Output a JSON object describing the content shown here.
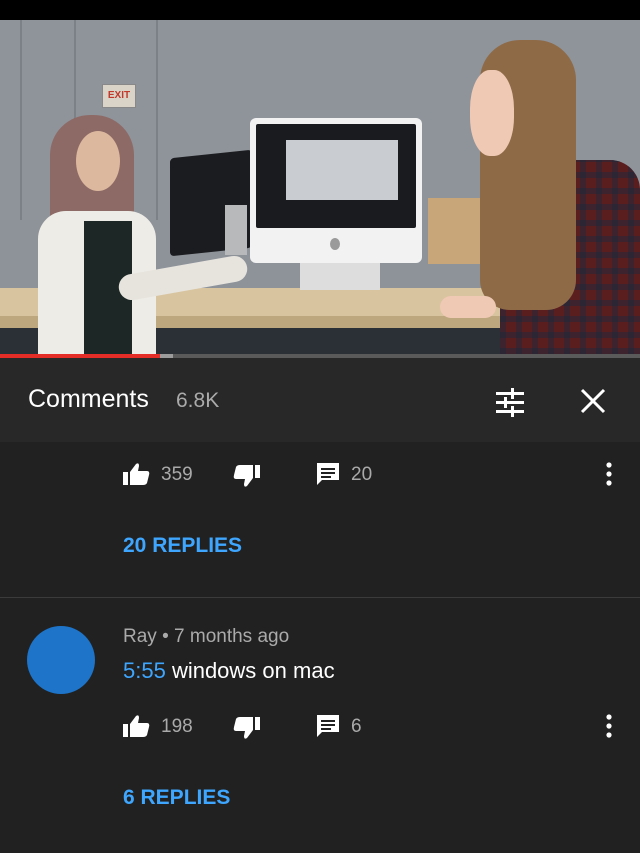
{
  "video": {
    "exit_sign_text": "EXIT",
    "progress_fraction": 0.25,
    "buffer_fraction": 0.27
  },
  "comments": {
    "title": "Comments",
    "count": "6.8K",
    "filter_icon": "sliders-icon",
    "close_icon": "close-icon"
  },
  "comment1": {
    "likes": "359",
    "replies_count": "20",
    "replies_link": "20 REPLIES"
  },
  "comment2": {
    "author": "Ray",
    "separator": "•",
    "age": "7 months ago",
    "timestamp": "5:55",
    "text": " windows on mac",
    "likes": "198",
    "replies_count": "6",
    "replies_link": "6 REPLIES",
    "avatar_color": "#1d74c9"
  },
  "colors": {
    "link": "#3ea6ff",
    "progress": "#e52d27",
    "background": "#212121",
    "header": "#282828"
  }
}
